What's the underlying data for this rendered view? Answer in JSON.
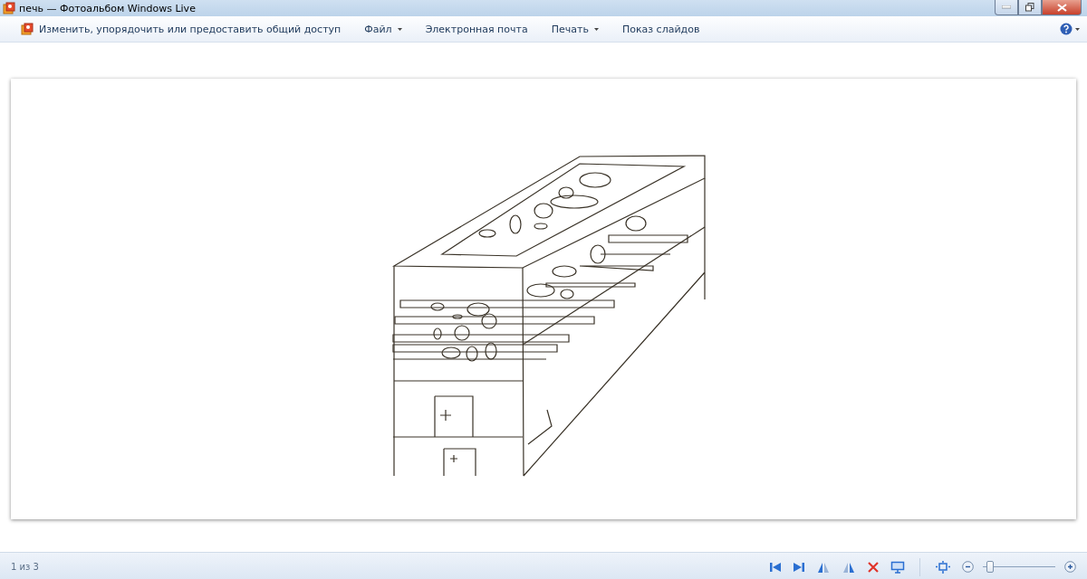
{
  "window": {
    "title": "печь — Фотоальбом Windows Live"
  },
  "toolbar": {
    "items": [
      {
        "label": "Изменить, упорядочить или предоставить общий доступ",
        "kind": "app"
      },
      {
        "label": "Файл",
        "kind": "menu"
      },
      {
        "label": "Электронная почта",
        "kind": "plain"
      },
      {
        "label": "Печать",
        "kind": "menu"
      },
      {
        "label": "Показ слайдов",
        "kind": "plain"
      }
    ]
  },
  "status_bar": {
    "counter": "1 из 3",
    "zoom": {
      "level": 0.05
    }
  }
}
